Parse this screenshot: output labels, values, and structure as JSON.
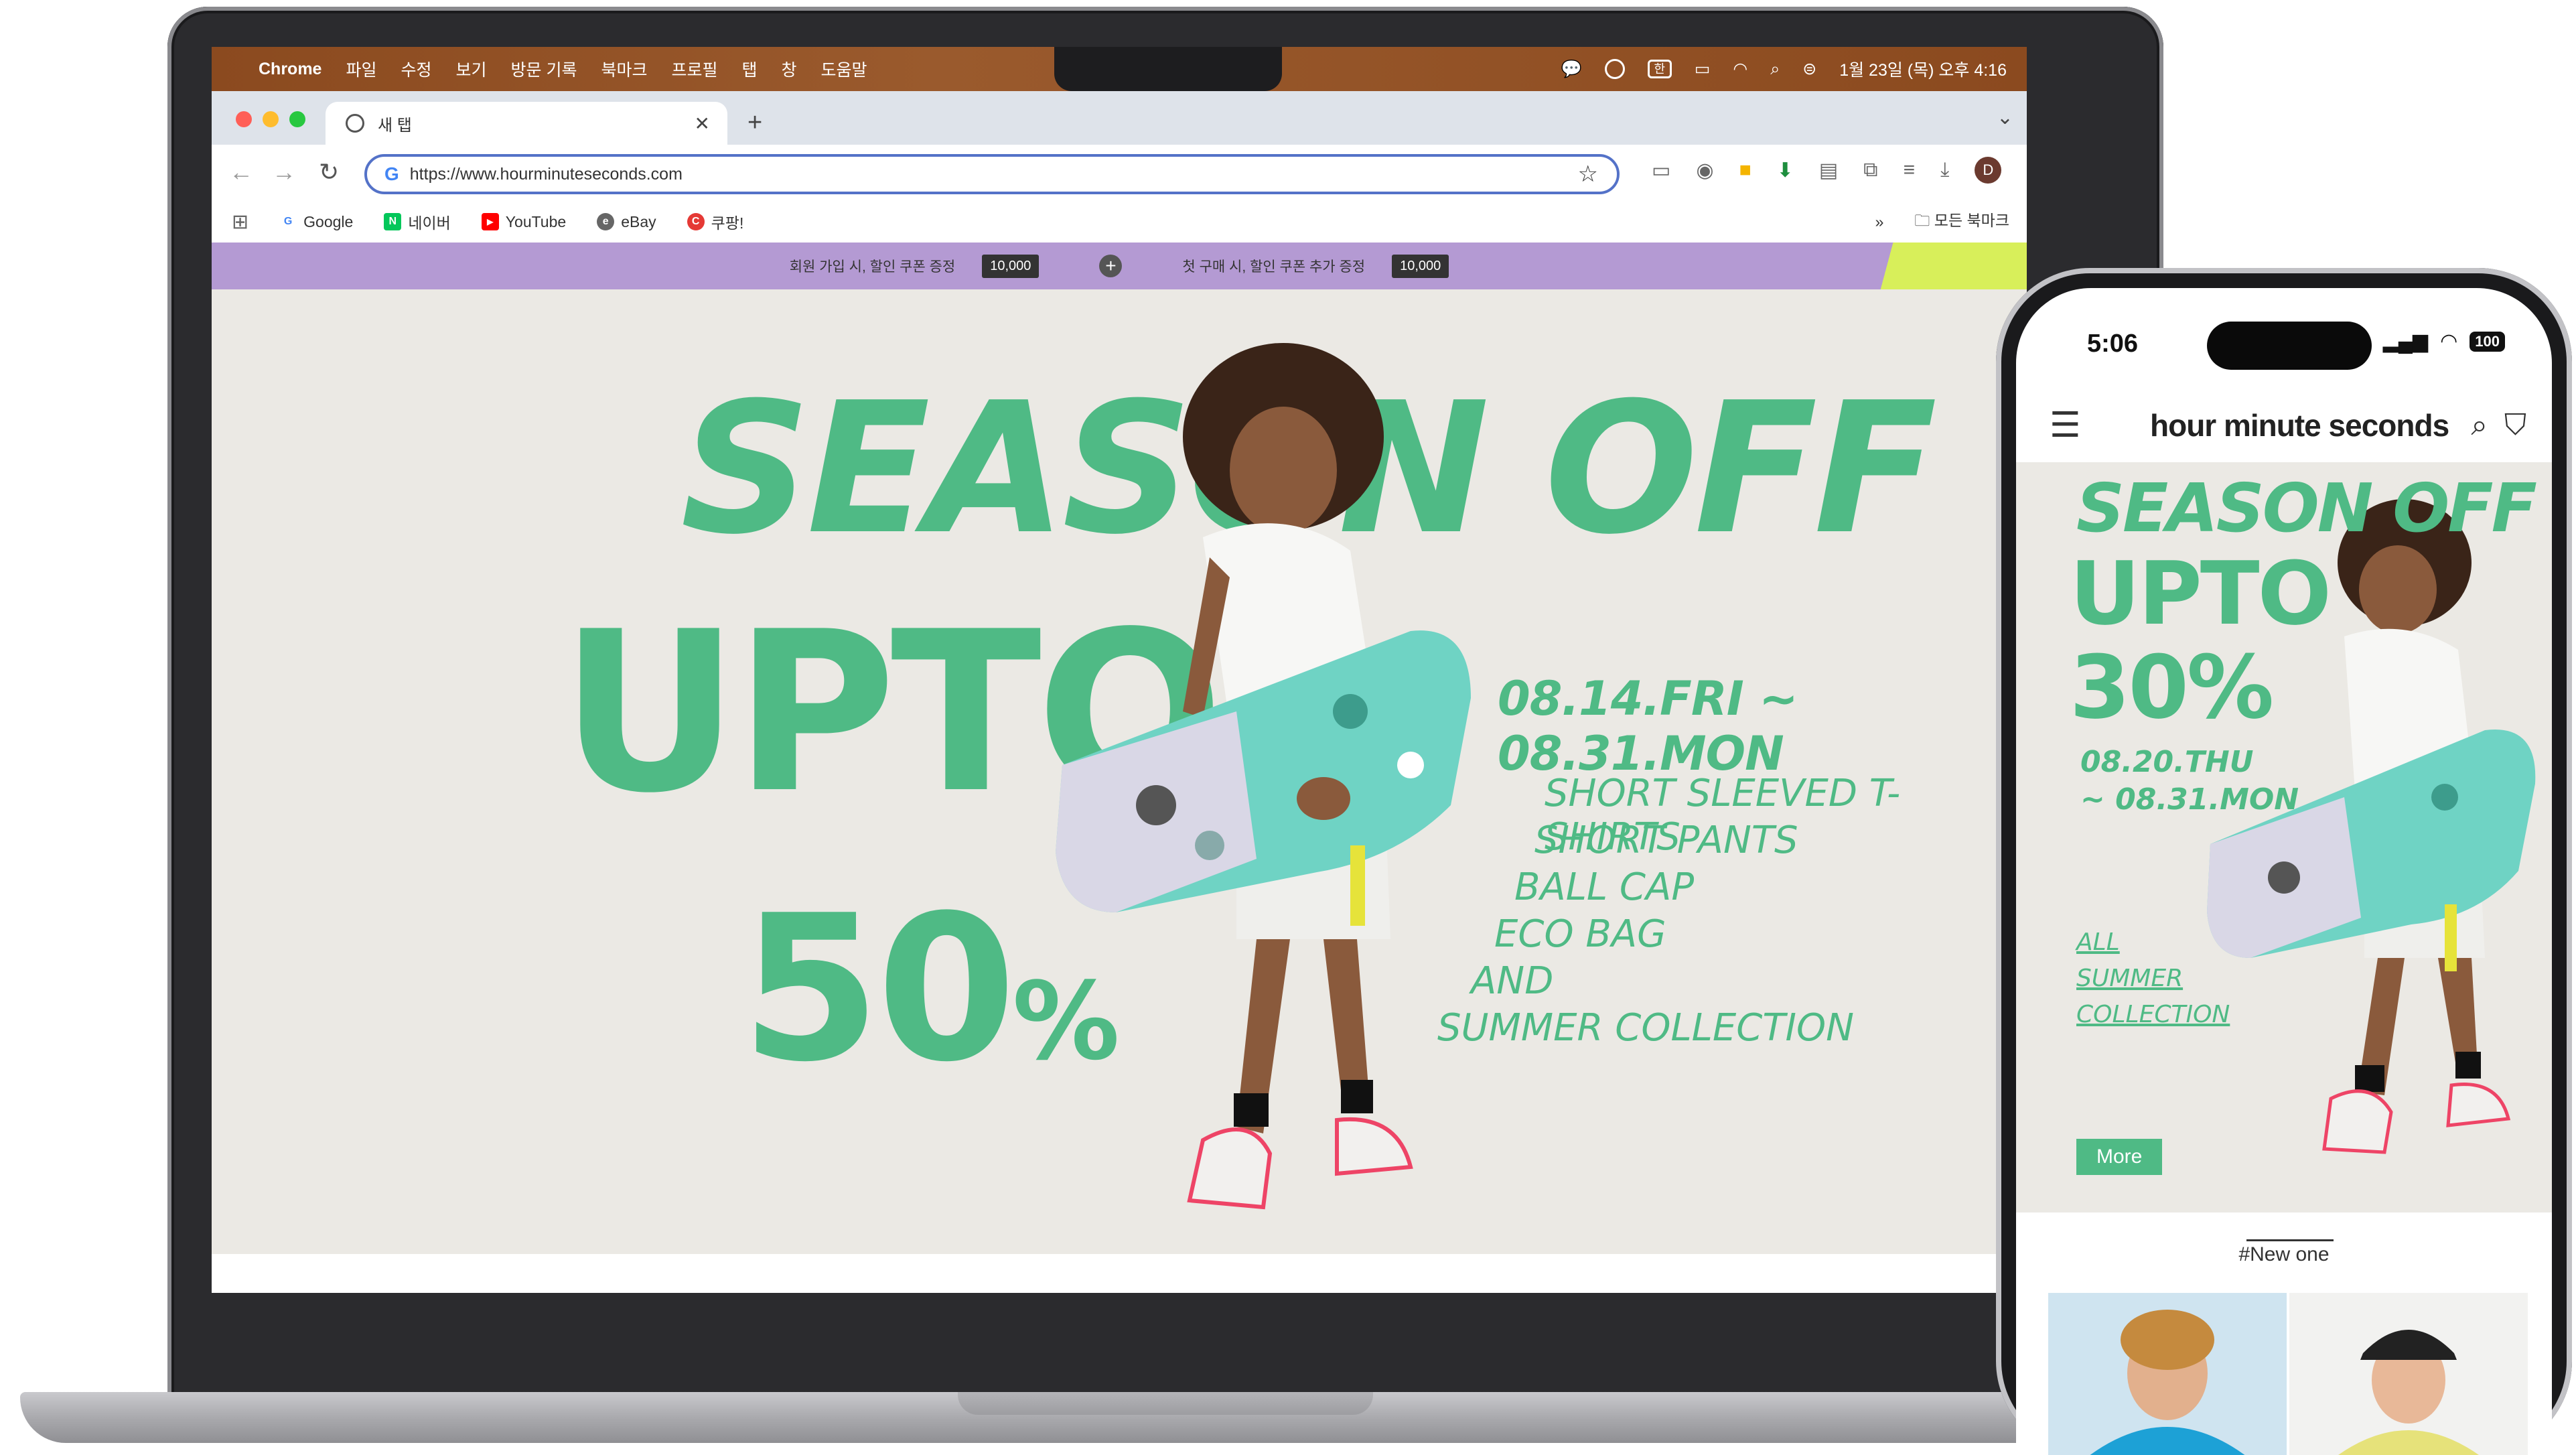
{
  "colors": {
    "brand_green": "#4fba85",
    "promo_purple": "#b49ad3",
    "promo_lime": "#d8ef5a",
    "hero_bg": "#ebe9e4"
  },
  "menubar": {
    "app_name": "Chrome",
    "items": [
      "파일",
      "수정",
      "보기",
      "방문 기록",
      "북마크",
      "프로필",
      "탭",
      "창",
      "도움말"
    ],
    "input_indicator": "한",
    "datetime": "1월 23일 (목) 오후 4:16"
  },
  "browser": {
    "tab_title": "새 탭",
    "url": "https://www.hourminuteseconds.com",
    "profile_initial": "D",
    "bookmarks": [
      {
        "label": "Google",
        "icon": "google-icon",
        "color": "#4285f4",
        "glyph": "G"
      },
      {
        "label": "네이버",
        "icon": "naver-icon",
        "color": "#03c75a",
        "glyph": "N"
      },
      {
        "label": "YouTube",
        "icon": "youtube-icon",
        "color": "#ff0000",
        "glyph": "▶"
      },
      {
        "label": "eBay",
        "icon": "ebay-icon",
        "color": "#666666",
        "glyph": "e"
      },
      {
        "label": "쿠팡!",
        "icon": "coupang-icon",
        "color": "#e53935",
        "glyph": "C"
      }
    ],
    "all_bookmarks": "모든 북마크"
  },
  "promo": {
    "left_text": "회원 가입 시, 할인 쿠폰 증정",
    "left_coupon": "10,000",
    "right_text": "첫 구매 시, 할인 쿠폰 추가 증정",
    "right_coupon": "10,000"
  },
  "hero": {
    "season": "SEASON OFF",
    "upto": "UPTO",
    "percent_value": "50",
    "percent_sign": "%",
    "dates": "08.14.FRI ~ 08.31.MON",
    "items": [
      "SHORT SLEEVED T-SHIRTS",
      "SHORT PANTS",
      "BALL CAP",
      "ECO BAG",
      "AND",
      "SUMMER COLLECTION"
    ]
  },
  "phone": {
    "time": "5:06",
    "battery": "100",
    "logo": "hour minute seconds",
    "season": "SEASON OFF",
    "upto": "UPTO",
    "percent": "30%",
    "date_start": "08.20.THU",
    "date_end": "~ 08.31.MON",
    "collection": [
      "ALL",
      "SUMMER",
      "COLLECTION"
    ],
    "more_button": "More",
    "new_section": "#New one"
  }
}
